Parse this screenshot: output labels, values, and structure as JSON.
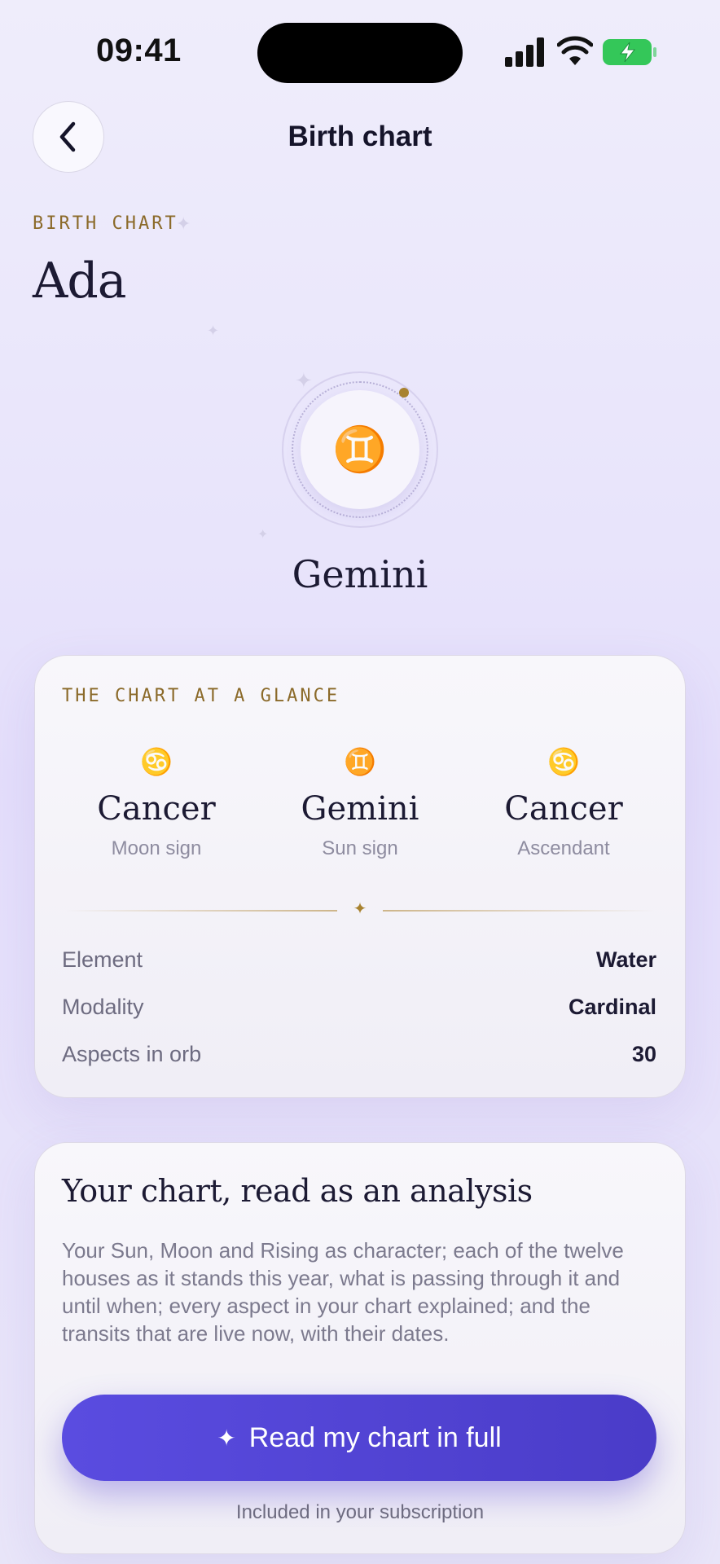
{
  "status_bar": {
    "time": "09:41"
  },
  "nav": {
    "title": "Birth chart"
  },
  "header": {
    "eyebrow": "BIRTH CHART",
    "name": "Ada"
  },
  "medallion": {
    "glyph": "♊",
    "sign": "Gemini"
  },
  "glance": {
    "label": "THE CHART AT A GLANCE",
    "columns": [
      {
        "glyph": "♋",
        "sign": "Cancer",
        "caption": "Moon sign"
      },
      {
        "glyph": "♊",
        "sign": "Gemini",
        "caption": "Sun sign"
      },
      {
        "glyph": "♋",
        "sign": "Cancer",
        "caption": "Ascendant"
      }
    ],
    "rows": [
      {
        "label": "Element",
        "value": "Water"
      },
      {
        "label": "Modality",
        "value": "Cardinal"
      },
      {
        "label": "Aspects in orb",
        "value": "30"
      }
    ]
  },
  "analysis": {
    "title": "Your chart, read as an analysis",
    "body": "Your Sun, Moon and Rising as character; each of the twelve houses as it stands this year, what is passing through it and until when; every aspect in your chart explained; and the transits that are live now, with their dates.",
    "cta_label": "Read my chart in full",
    "note": "Included in your subscription"
  },
  "icons": {
    "back": "chevron-left-icon",
    "signal": "cellular-signal-icon",
    "wifi": "wifi-icon",
    "battery": "battery-charging-icon",
    "sparkle": "sparkle-icon"
  },
  "colors": {
    "accent": "#5a4ce0",
    "gold": "#8b6a2a",
    "teal": "#2d9585",
    "battery": "#34c759"
  }
}
